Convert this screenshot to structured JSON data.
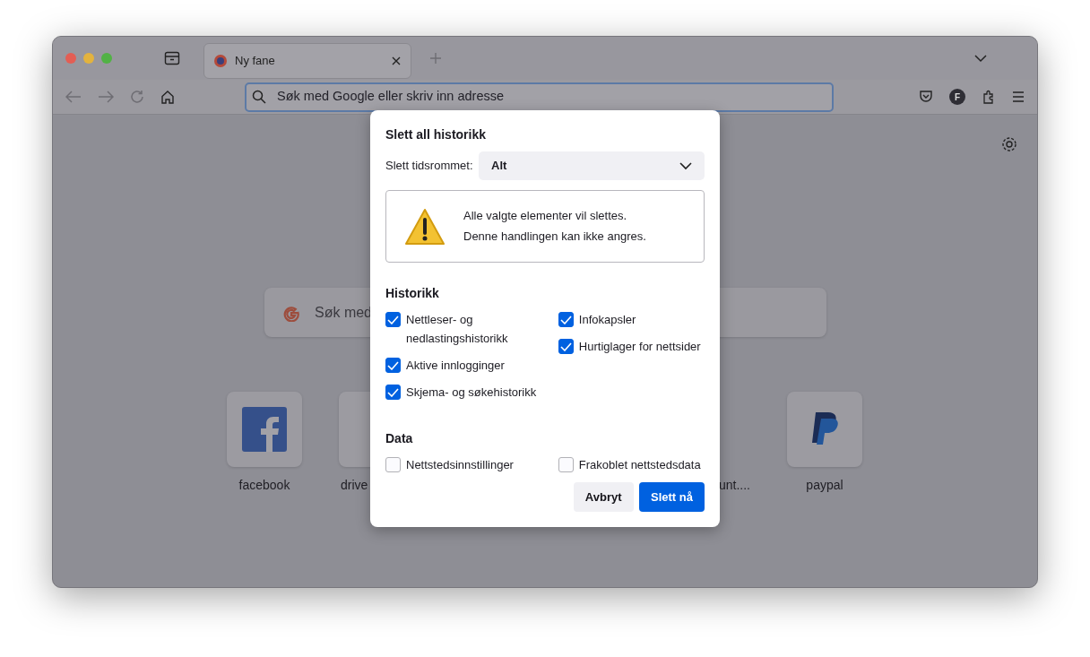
{
  "window": {
    "tab": {
      "title": "Ny fane",
      "selected": true
    },
    "address": {
      "placeholder": "Søk med Google eller skriv inn adresse"
    },
    "account_initial": "F"
  },
  "newtab": {
    "search": {
      "placeholder": "Søk med"
    },
    "shortcuts": [
      {
        "label": "facebook",
        "kind": "facebook"
      },
      {
        "label": "drive",
        "kind": "drive"
      },
      {
        "label": "unt....",
        "kind": "hidden"
      },
      {
        "label": "paypal",
        "kind": "paypal"
      }
    ]
  },
  "dialog": {
    "title": "Slett all historikk",
    "range_label": "Slett tidsrommet:",
    "range_value": "Alt",
    "warning": [
      "Alle valgte elementer vil slettes.",
      "Denne handlingen kan ikke angres."
    ],
    "sections": [
      {
        "title": "Historikk",
        "columns": [
          [
            {
              "label": "Nettleser- og nedlastingshistorikk",
              "checked": true
            },
            {
              "label": "Aktive innlogginger",
              "checked": true
            },
            {
              "label": "Skjema- og søkehistorikk",
              "checked": true
            }
          ],
          [
            {
              "label": "Infokapsler",
              "checked": true
            },
            {
              "label": "Hurtiglager for nettsider",
              "checked": true
            }
          ]
        ]
      },
      {
        "title": "Data",
        "columns": [
          [
            {
              "label": "Nettstedsinnstillinger",
              "checked": false
            }
          ],
          [
            {
              "label": "Frakoblet nettstedsdata",
              "checked": false
            }
          ]
        ]
      }
    ],
    "buttons": [
      {
        "label": "Avbryt",
        "kind": "secondary"
      },
      {
        "label": "Slett nå",
        "kind": "primary"
      }
    ]
  }
}
